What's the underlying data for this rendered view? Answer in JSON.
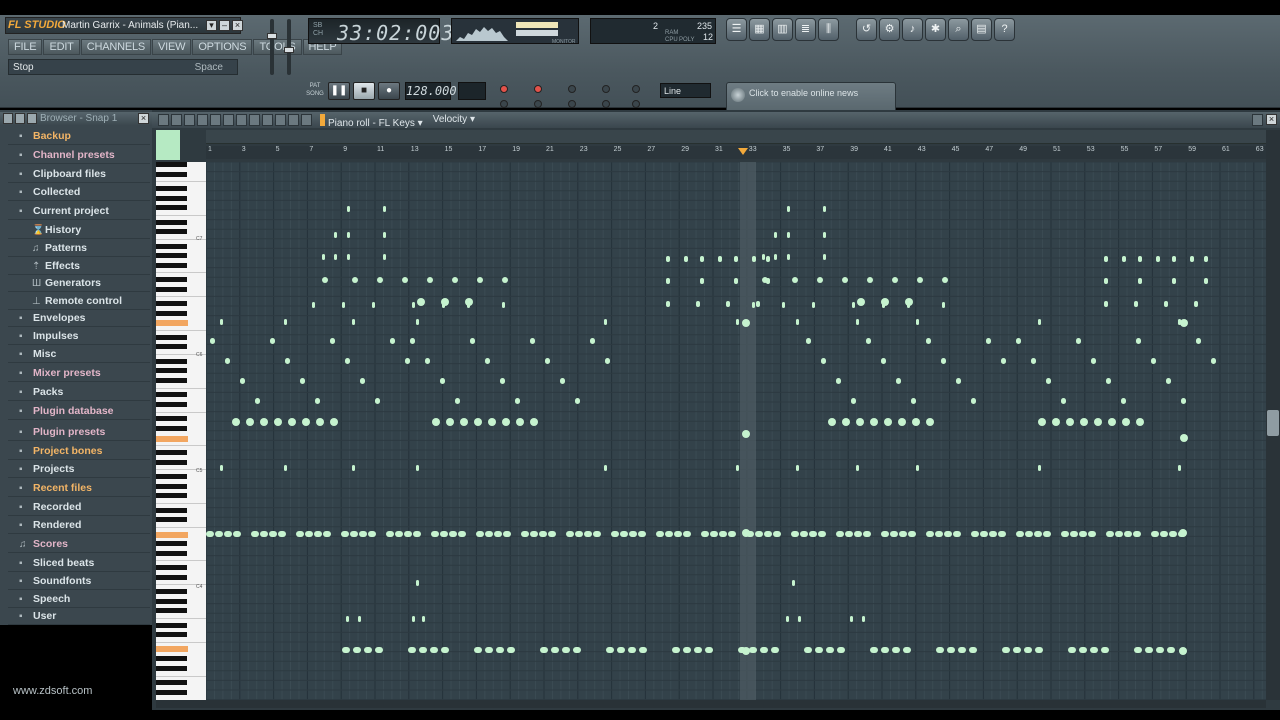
{
  "app": {
    "logo": "FL STUDIO",
    "song_title": "Martin Garrix - Animals (Pian...",
    "window_buttons": [
      "▾",
      "–",
      "×"
    ]
  },
  "menu": [
    "FILE",
    "EDIT",
    "CHANNELS",
    "VIEW",
    "OPTIONS",
    "TOOLS",
    "HELP"
  ],
  "hint": {
    "text": "Stop",
    "key": "Space"
  },
  "time_display": {
    "value": "33:02:003",
    "mode_top": "SB",
    "mode_bottom": "CH"
  },
  "cpu": {
    "voices": "2",
    "ram": "235",
    "poly": "12",
    "ram_label": "RAM",
    "cpu_label": "CPU",
    "poly_label": "POLY",
    "monitor_label": "MONITOR"
  },
  "transport": {
    "tempo": "128.000",
    "pat_label": "PAT",
    "song_label": "SONG",
    "line_mode": "Line"
  },
  "news": {
    "text": "Click to enable online news"
  },
  "browser": {
    "title": "Browser - Snap 1",
    "items": [
      {
        "label": "Backup",
        "icon": "folder-icon",
        "style": "orange",
        "sub": false
      },
      {
        "label": "Channel presets",
        "icon": "folder-icon",
        "style": "pink",
        "sub": false
      },
      {
        "label": "Clipboard files",
        "icon": "folder-icon",
        "style": "normal",
        "sub": false
      },
      {
        "label": "Collected",
        "icon": "folder-icon",
        "style": "normal",
        "sub": false
      },
      {
        "label": "Current project",
        "icon": "folder-icon",
        "style": "normal",
        "sub": false
      },
      {
        "label": "History",
        "icon": "history-icon",
        "style": "normal",
        "sub": true
      },
      {
        "label": "Patterns",
        "icon": "note-icon",
        "style": "normal",
        "sub": true
      },
      {
        "label": "Effects",
        "icon": "plug-icon",
        "style": "normal",
        "sub": true
      },
      {
        "label": "Generators",
        "icon": "generator-icon",
        "style": "normal",
        "sub": true
      },
      {
        "label": "Remote control",
        "icon": "slider-icon",
        "style": "normal",
        "sub": true
      },
      {
        "label": "Envelopes",
        "icon": "folder-icon",
        "style": "normal",
        "sub": false
      },
      {
        "label": "Impulses",
        "icon": "folder-icon",
        "style": "normal",
        "sub": false
      },
      {
        "label": "Misc",
        "icon": "folder-icon",
        "style": "normal",
        "sub": false
      },
      {
        "label": "Mixer presets",
        "icon": "folder-icon",
        "style": "pink",
        "sub": false
      },
      {
        "label": "Packs",
        "icon": "folder-icon",
        "style": "normal",
        "sub": false
      },
      {
        "label": "Plugin database",
        "icon": "folder-icon",
        "style": "pink",
        "sub": false
      },
      {
        "label": "Plugin presets",
        "icon": "folder-icon",
        "style": "pink",
        "sub": false
      },
      {
        "label": "Project bones",
        "icon": "folder-icon",
        "style": "orange",
        "sub": false
      },
      {
        "label": "Projects",
        "icon": "folder-icon",
        "style": "normal",
        "sub": false
      },
      {
        "label": "Recent files",
        "icon": "folder-icon",
        "style": "orange",
        "sub": false
      },
      {
        "label": "Recorded",
        "icon": "folder-icon",
        "style": "normal",
        "sub": false
      },
      {
        "label": "Rendered",
        "icon": "folder-icon",
        "style": "normal",
        "sub": false
      },
      {
        "label": "Scores",
        "icon": "note-icon",
        "style": "pink",
        "sub": false
      },
      {
        "label": "Sliced beats",
        "icon": "folder-icon",
        "style": "normal",
        "sub": false
      },
      {
        "label": "Soundfonts",
        "icon": "folder-icon",
        "style": "normal",
        "sub": false
      },
      {
        "label": "Speech",
        "icon": "folder-icon",
        "style": "normal",
        "sub": false
      },
      {
        "label": "User",
        "icon": "folder-icon",
        "style": "normal",
        "sub": false
      }
    ]
  },
  "watermark": "www.zdsoft.com",
  "piano_roll": {
    "title": "Piano roll - FL Keys",
    "control": "Velocity",
    "bar_numbers": [
      "1",
      "3",
      "5",
      "7",
      "9",
      "11",
      "13",
      "15",
      "17",
      "19",
      "21",
      "23",
      "25",
      "27",
      "29",
      "31",
      "33",
      "35",
      "37",
      "39",
      "41",
      "43",
      "45",
      "47",
      "49",
      "51",
      "53",
      "55",
      "57",
      "59",
      "61",
      "63"
    ],
    "octave_labels": [
      "C7",
      "C6",
      "C5",
      "C4",
      "C3"
    ],
    "playhead_bar": 33
  },
  "colors": {
    "accent": "#f2a93b",
    "note": "#c6f3cf",
    "grid": "#33424a",
    "browser_bg": "#3b474e"
  }
}
